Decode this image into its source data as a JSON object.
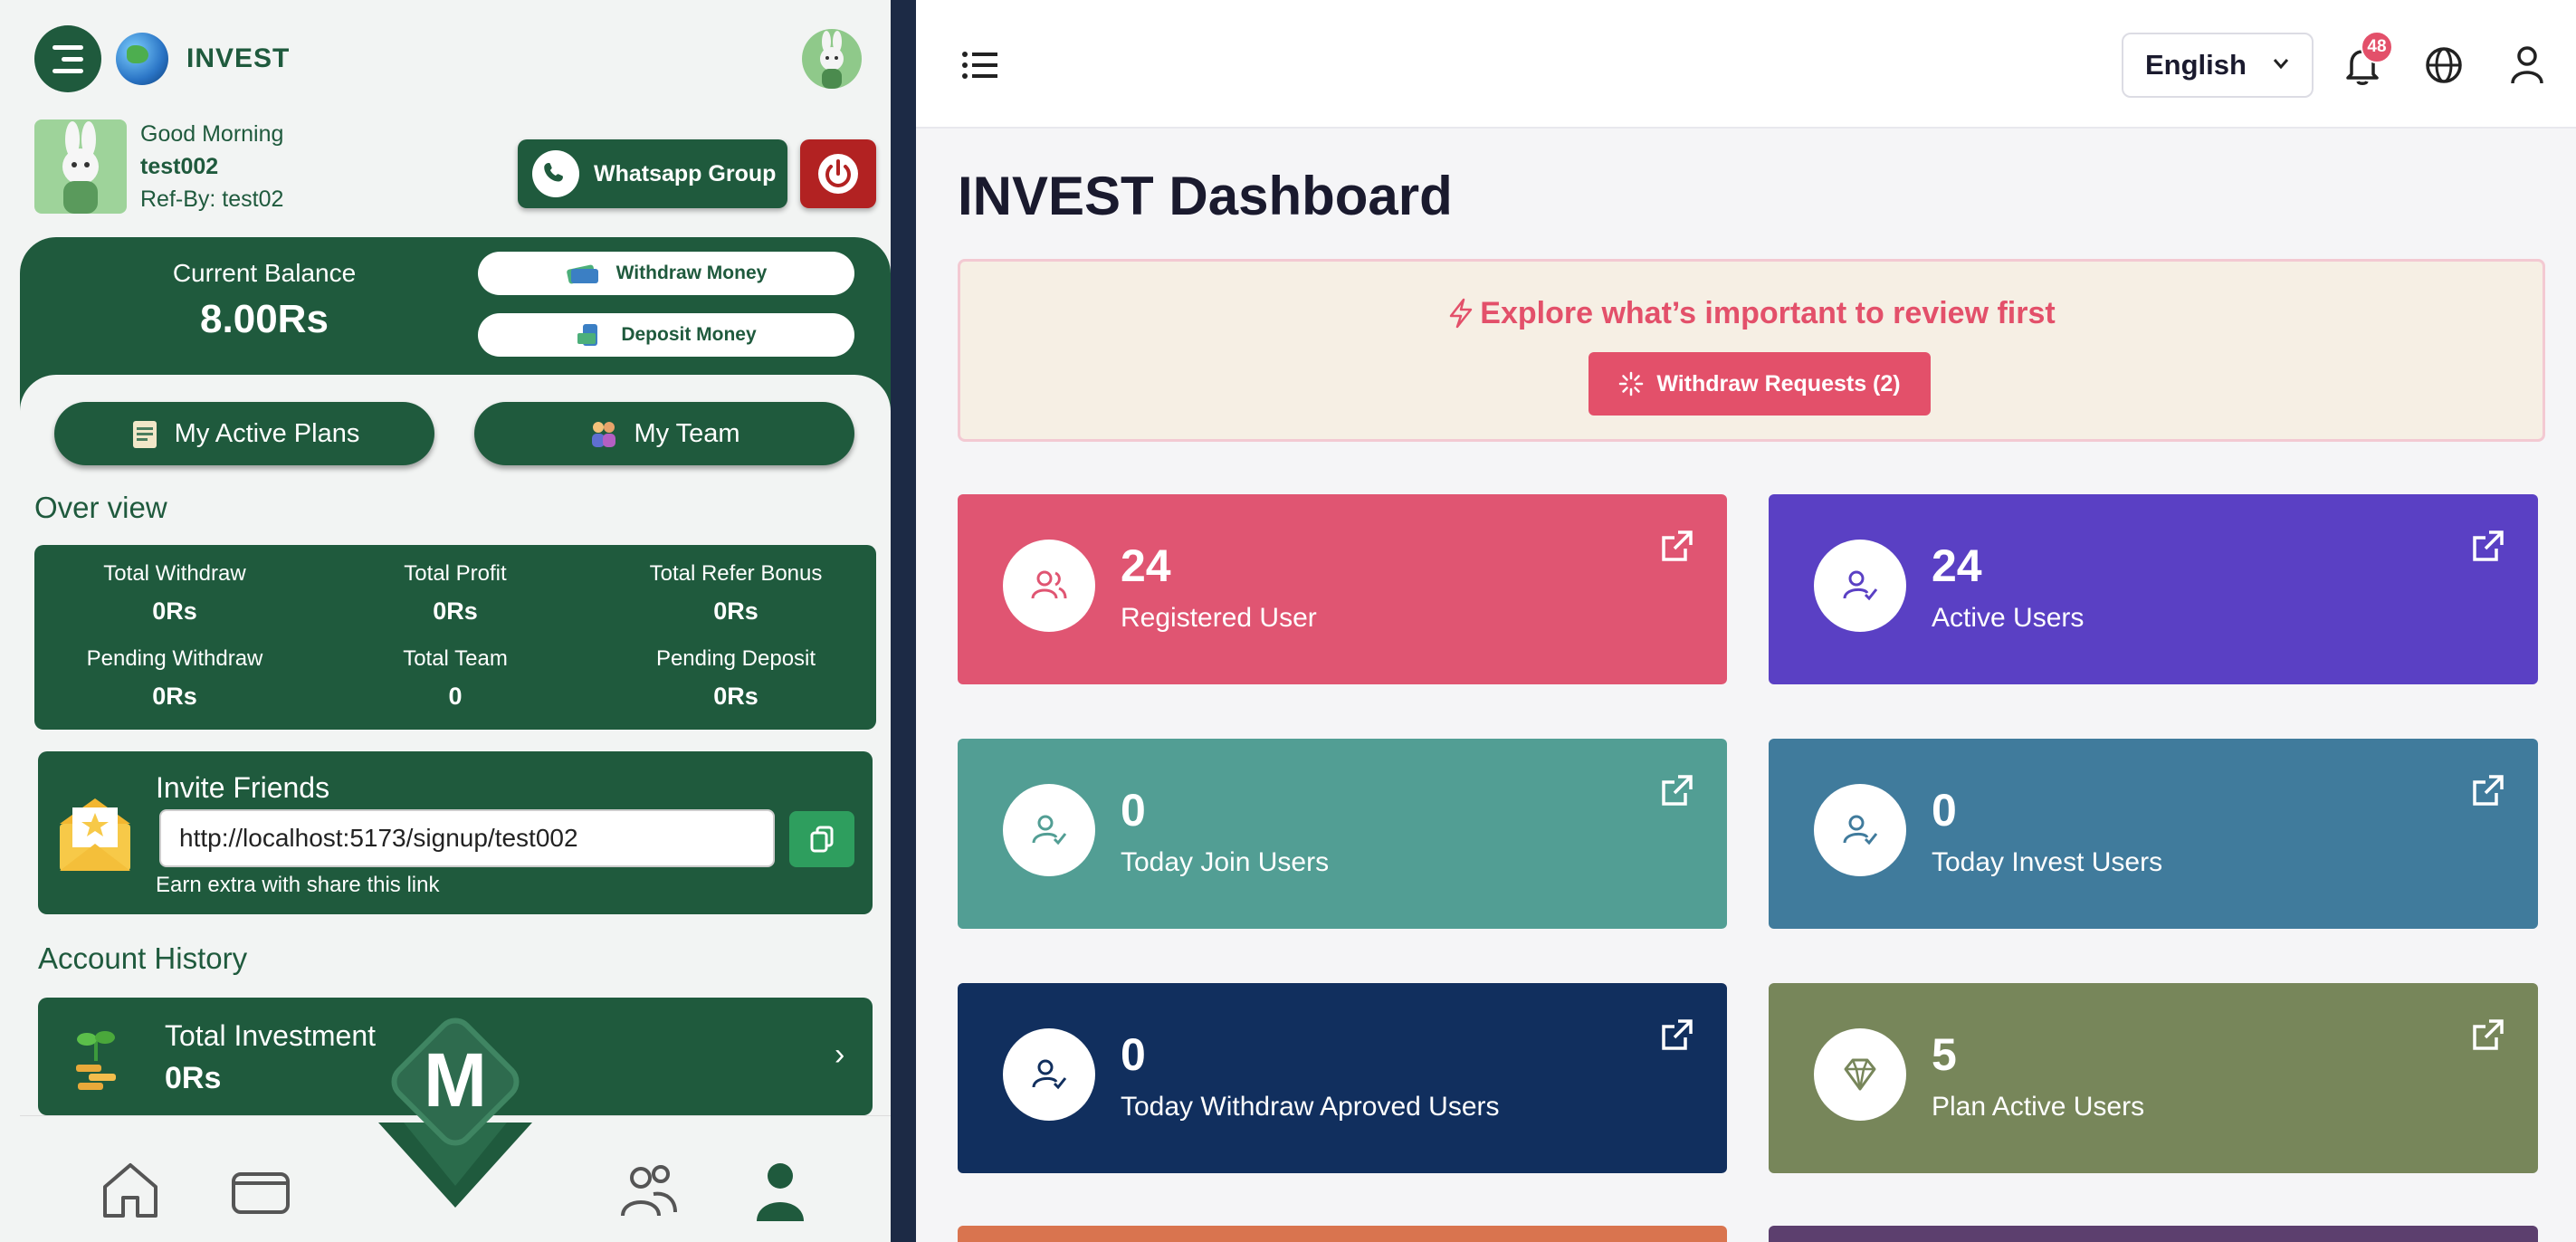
{
  "mobile": {
    "brand": "INVEST",
    "greeting": "Good Morning",
    "username": "test002",
    "ref_by": "Ref-By: test02",
    "whatsapp_label": "Whatsapp Group",
    "balance_label": "Current Balance",
    "balance_value": "8.00Rs",
    "withdraw_label": "Withdraw Money",
    "deposit_label": "Deposit Money",
    "active_plans_label": "My Active Plans",
    "my_team_label": "My Team",
    "overview_title": "Over view",
    "stats": [
      {
        "label": "Total Withdraw",
        "value": "0Rs"
      },
      {
        "label": "Total Profit",
        "value": "0Rs"
      },
      {
        "label": "Total Refer Bonus",
        "value": "0Rs"
      },
      {
        "label": "Pending Withdraw",
        "value": "0Rs"
      },
      {
        "label": "Total Team",
        "value": "0"
      },
      {
        "label": "Pending Deposit",
        "value": "0Rs"
      }
    ],
    "invite": {
      "title": "Invite Friends",
      "link": "http://localhost:5173/signup/test002",
      "note": "Earn extra with share this link"
    },
    "history_title": "Account History",
    "history_card": {
      "label": "Total Investment",
      "value": "0Rs"
    },
    "center_logo_letter": "M"
  },
  "admin": {
    "language": "English",
    "notification_count": "48",
    "title": "INVEST Dashboard",
    "alert_text": "Explore what’s important to review first",
    "alert_button": "Withdraw Requests (2)",
    "cards": [
      {
        "value": "24",
        "label": "Registered User",
        "color": "#e05572",
        "icon": "users-icon"
      },
      {
        "value": "24",
        "label": "Active Users",
        "color": "#5a40c4",
        "icon": "user-check-icon"
      },
      {
        "value": "0",
        "label": "Today Join Users",
        "color": "#529e94",
        "icon": "user-check-icon"
      },
      {
        "value": "0",
        "label": "Today Invest Users",
        "color": "#407b9c",
        "icon": "user-check-icon"
      },
      {
        "value": "0",
        "label": "Today Withdraw Aproved Users",
        "color": "#112f5e",
        "icon": "user-check-icon"
      },
      {
        "value": "5",
        "label": "Plan Active Users",
        "color": "#77865a",
        "icon": "diamond-icon"
      }
    ]
  },
  "colors": {
    "brand_green": "#1f5a3d",
    "accent_pink": "#e3506a"
  }
}
